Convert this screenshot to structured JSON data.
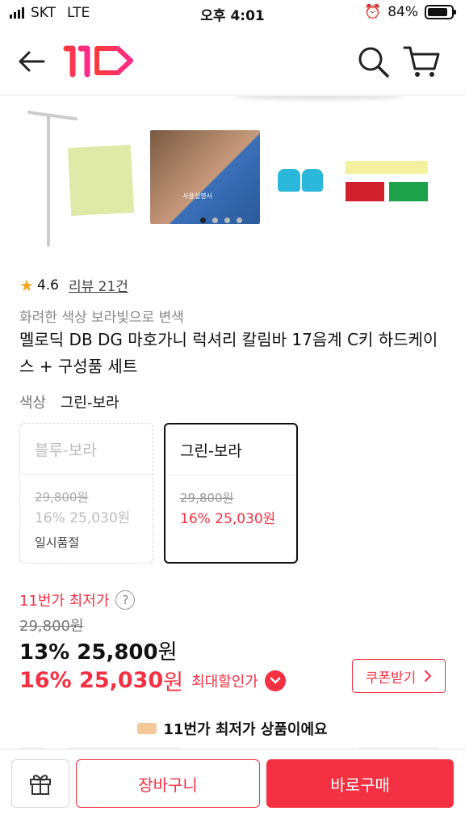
{
  "status_bar": {
    "carrier": "SKT",
    "network": "LTE",
    "time": "오후 4:01",
    "battery": "84%",
    "battery_level": 0.84
  },
  "header": {
    "logo_text": "11",
    "icons": [
      "back-arrow-icon",
      "11st-logo",
      "search-icon",
      "cart-icon"
    ]
  },
  "gallery": {
    "photo_caption": "사용설명서",
    "page_count": 4,
    "active_page": 1
  },
  "product": {
    "rating": "4.6",
    "review_link": "리뷰 21건",
    "subtitle": "화려한 색상 보라빛으로 변색",
    "title": "멜로딕 DB DG 마호가니 럭셔리 칼림바 17음계 C키 하드케이스 + 구성품 세트"
  },
  "option": {
    "label": "색상",
    "selected_value": "그린-보라",
    "cards": [
      {
        "name": "블루-보라",
        "original_price": "29,800원",
        "discount_price": "16% 25,030원",
        "stock": "일시품절",
        "selected": false
      },
      {
        "name": "그린-보라",
        "original_price": "29,800원",
        "discount_price": "16% 25,030원",
        "stock": "",
        "selected": true
      }
    ]
  },
  "price": {
    "lowest_label": "11번가 최저가",
    "help": "?",
    "original": "29,800원",
    "main_amount": "13% 25,800",
    "main_unit": "원",
    "max_amount": "16% 25,030",
    "max_unit": "원",
    "max_tag": "최대할인가",
    "coupon_button": "쿠폰받기"
  },
  "banner": {
    "text": "11번가 최저가 상품이에요"
  },
  "bottom_bar": {
    "cart_button": "장바구니",
    "buy_button": "바로구매"
  },
  "colors": {
    "accent": "#f43142",
    "muted": "#8a8a8a",
    "star": "#f5a623"
  }
}
